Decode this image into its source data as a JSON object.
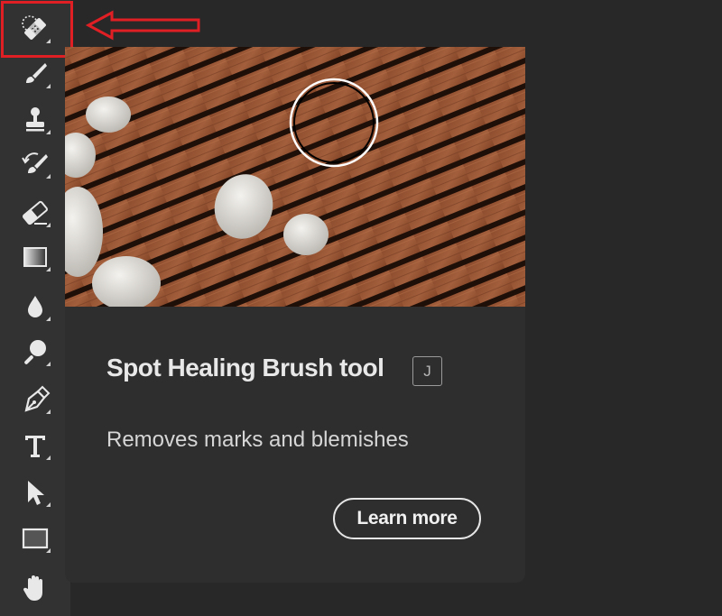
{
  "toolbar": {
    "tools": [
      {
        "name": "spot-healing-brush-icon",
        "selected": true
      },
      {
        "name": "brush-icon"
      },
      {
        "name": "clone-stamp-icon"
      },
      {
        "name": "history-brush-icon"
      },
      {
        "name": "eraser-icon"
      },
      {
        "name": "gradient-icon"
      },
      {
        "name": "blur-icon"
      },
      {
        "name": "dodge-icon"
      },
      {
        "name": "pen-icon"
      },
      {
        "name": "type-icon"
      },
      {
        "name": "path-selection-icon"
      },
      {
        "name": "rectangle-icon"
      },
      {
        "name": "hand-icon"
      }
    ]
  },
  "annotation": {
    "highlight_color": "#e01f25",
    "arrow_icon": "left-arrow-icon"
  },
  "tooltip": {
    "title": "Spot Healing Brush tool",
    "shortcut": "J",
    "description": "Removes marks and blemishes",
    "learn_more_label": "Learn more"
  }
}
